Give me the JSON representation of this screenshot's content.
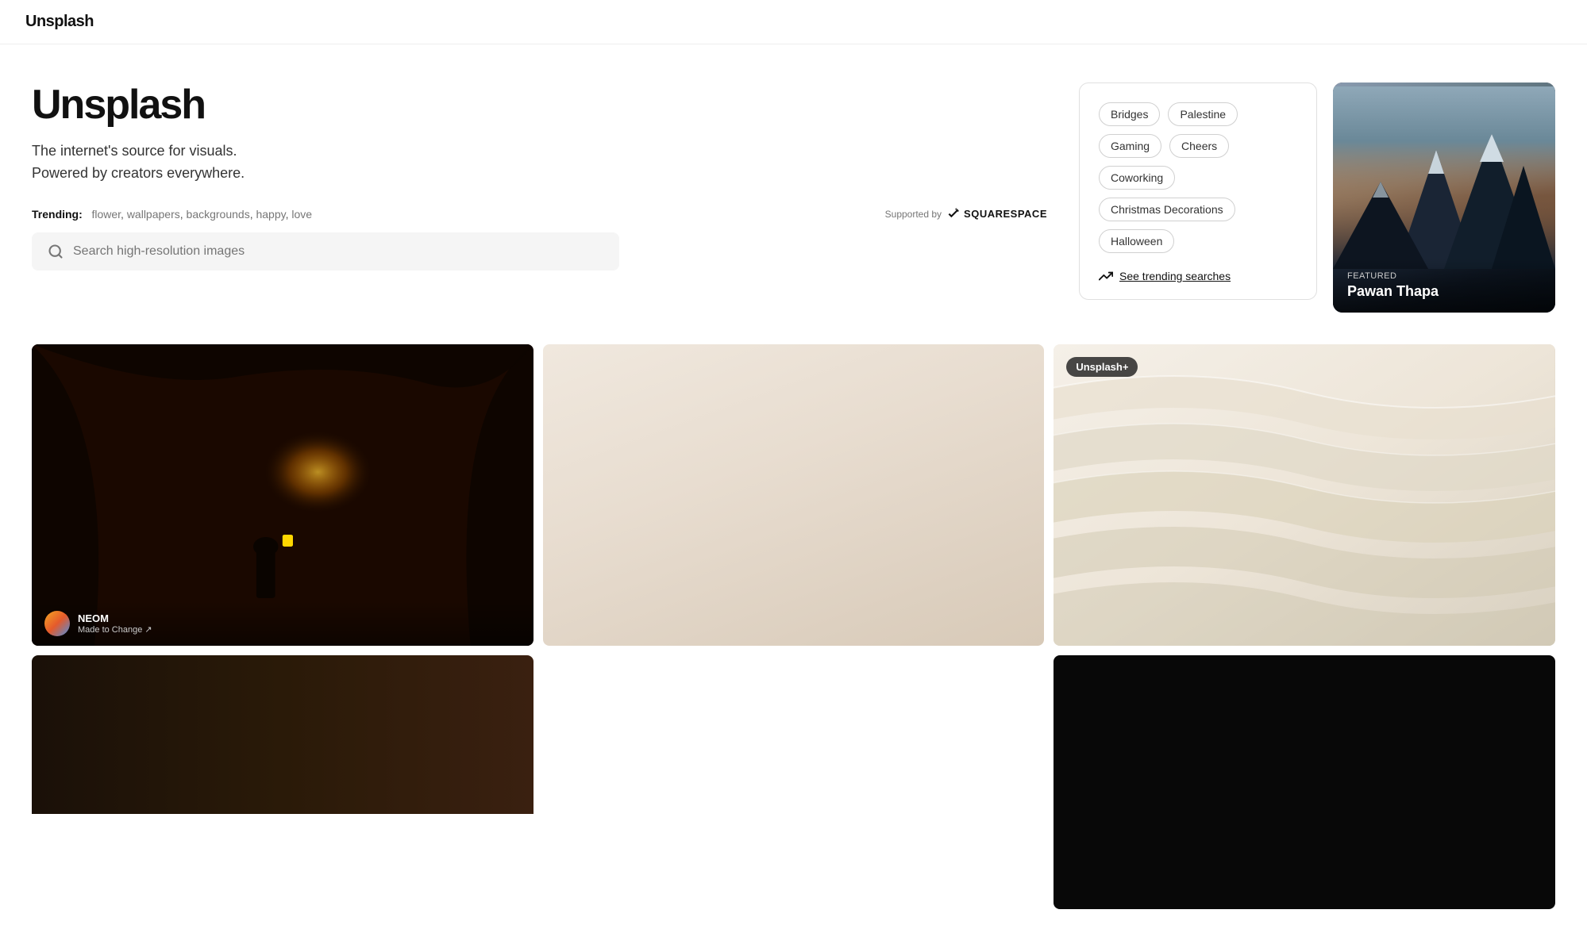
{
  "brand": {
    "name": "Unsplash"
  },
  "hero": {
    "title": "Unsplash",
    "subtitle_line1": "The internet's source for visuals.",
    "subtitle_line2": "Powered by creators everywhere.",
    "trending_label": "Trending:",
    "trending_items": [
      "flower",
      "wallpapers",
      "backgrounds",
      "happy",
      "love"
    ],
    "sponsored_label": "Supported by",
    "sponsor_name": "SQUARESPACE",
    "search_placeholder": "Search high-resolution images"
  },
  "trending_tags": {
    "tags": [
      "Bridges",
      "Palestine",
      "Gaming",
      "Cheers",
      "Coworking",
      "Christmas Decorations",
      "Halloween"
    ],
    "see_trending_label": "See trending searches"
  },
  "featured": {
    "label": "Featured",
    "photographer": "Pawan Thapa"
  },
  "photos": [
    {
      "id": "photo-1",
      "credit_name": "NEOM",
      "credit_sub": "Made to Change ↗"
    },
    {
      "id": "photo-2",
      "credit_name": "",
      "credit_sub": ""
    },
    {
      "id": "photo-3",
      "badge": "Unsplash+",
      "credit_name": "",
      "credit_sub": ""
    },
    {
      "id": "photo-4",
      "credit_name": "",
      "credit_sub": ""
    }
  ]
}
